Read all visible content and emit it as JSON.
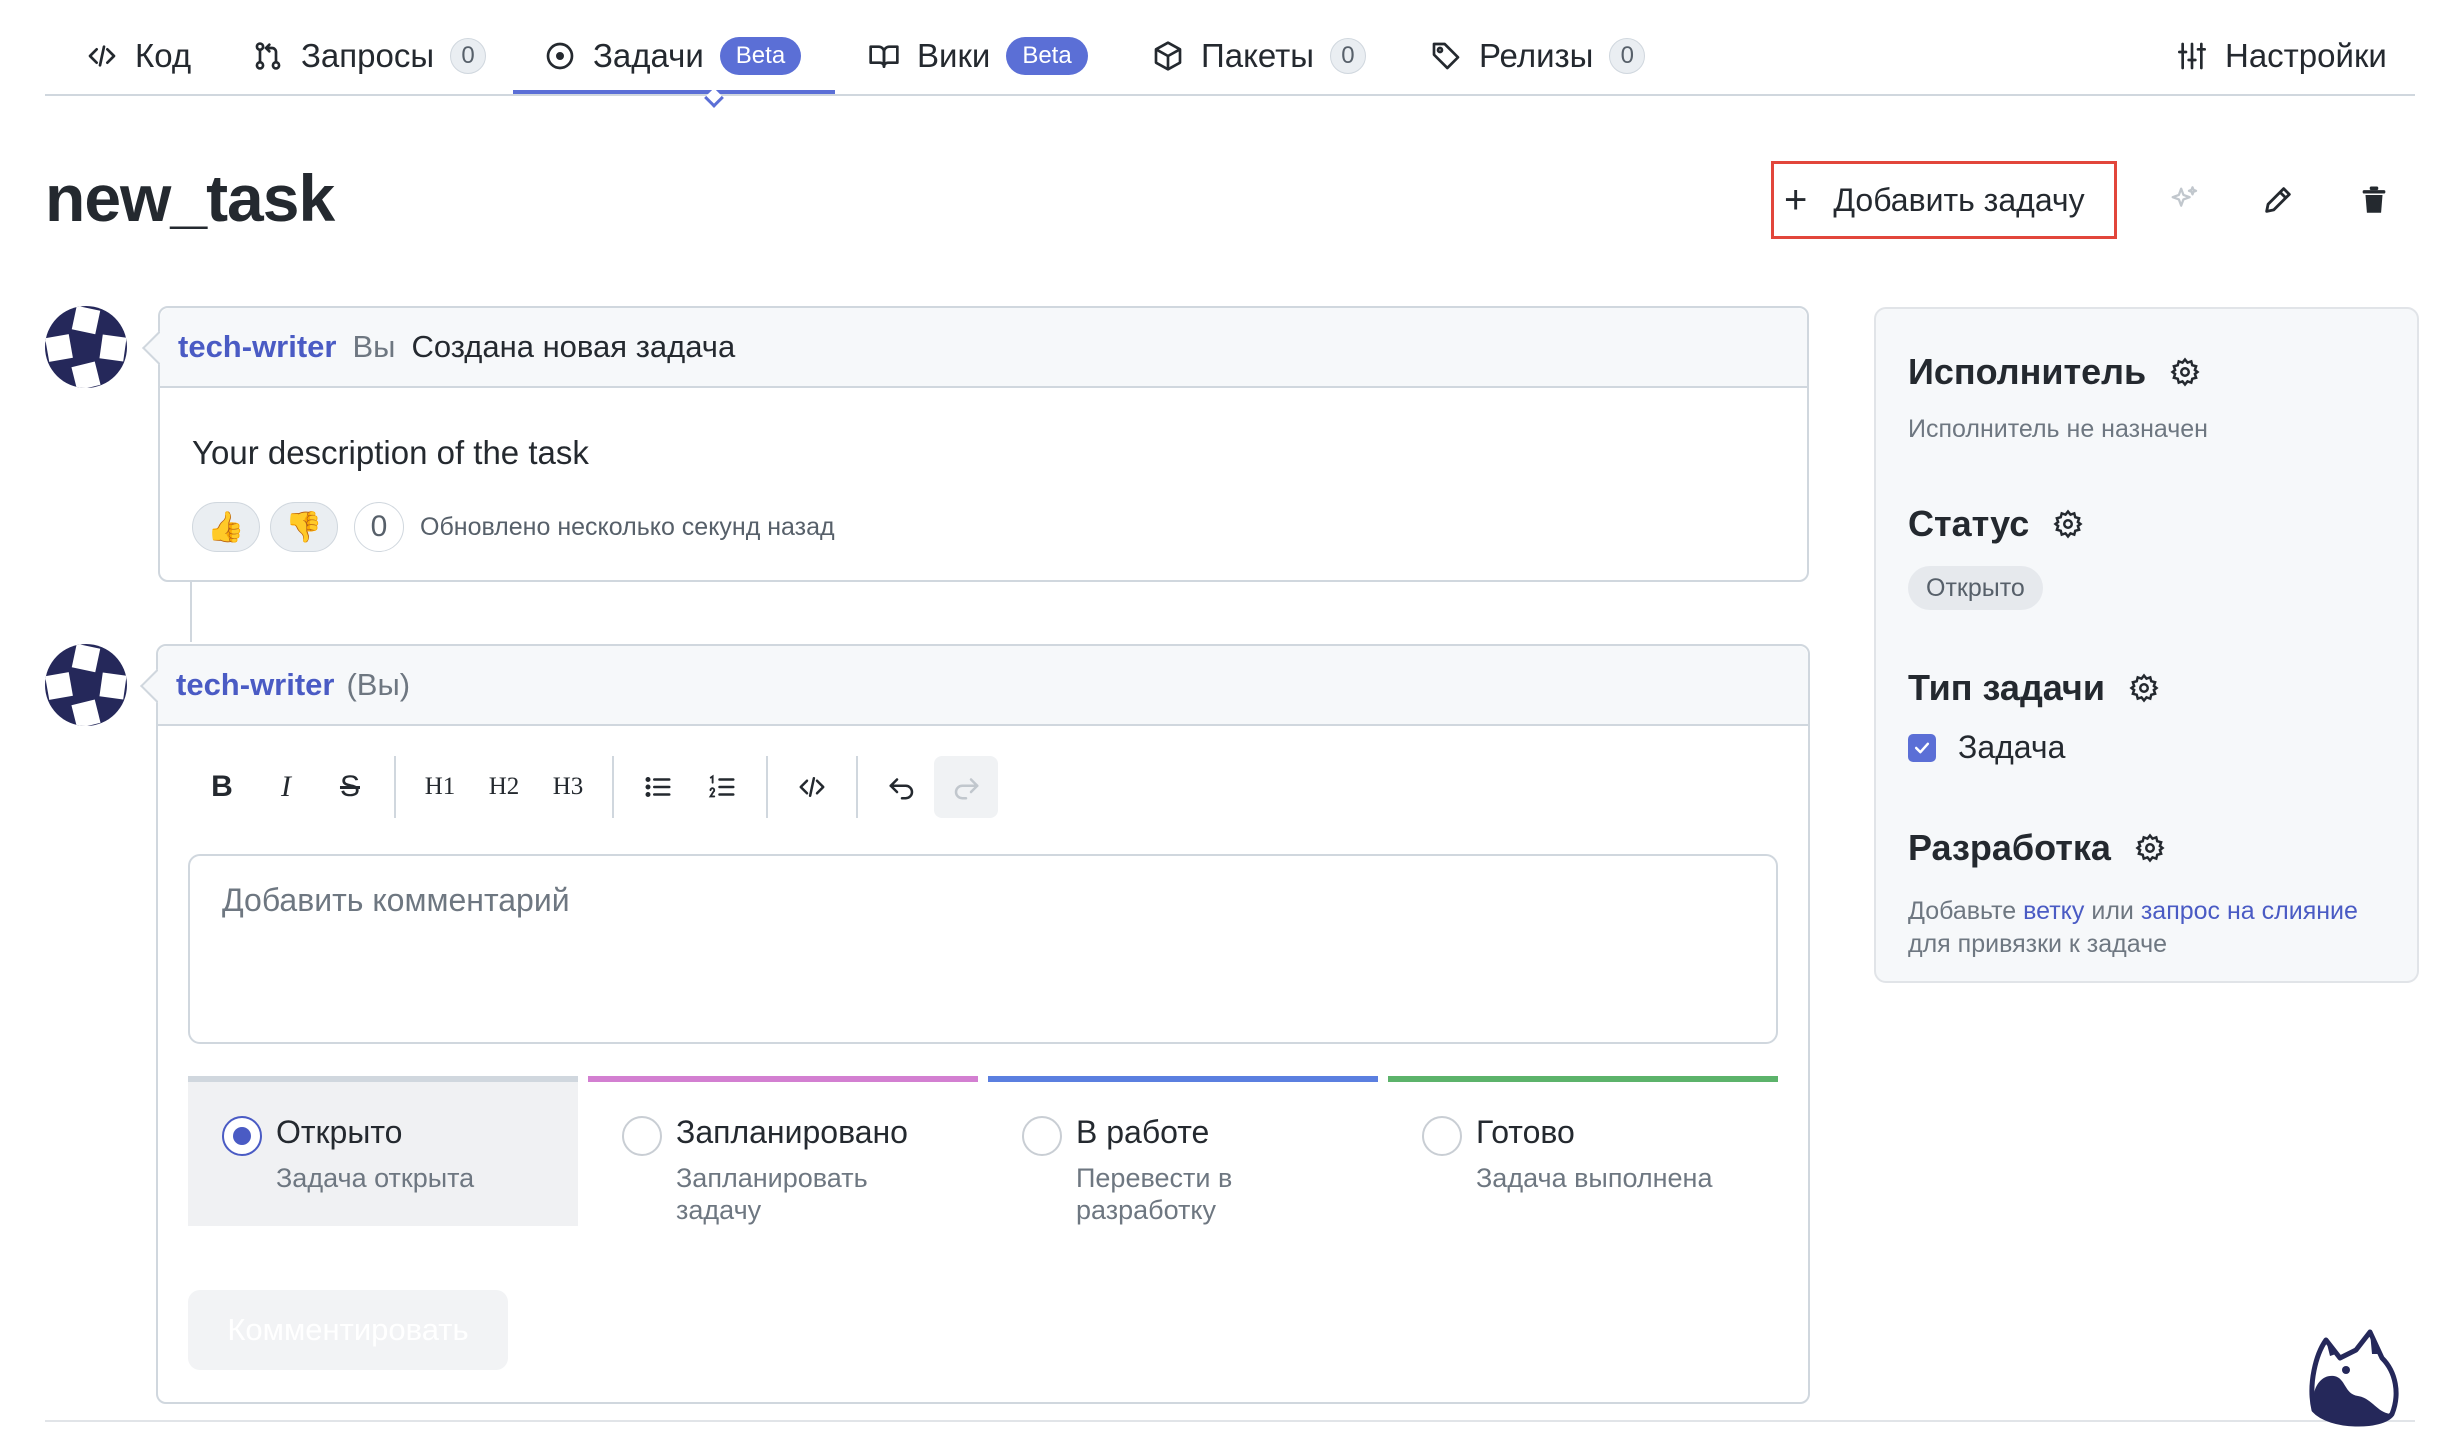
{
  "tabs": [
    {
      "label": "Код",
      "icon": "code-icon"
    },
    {
      "label": "Запросы",
      "icon": "pull-request-icon",
      "count": "0"
    },
    {
      "label": "Задачи",
      "icon": "issue-icon",
      "badge": "Beta",
      "active": true
    },
    {
      "label": "Вики",
      "icon": "book-icon",
      "badge": "Beta"
    },
    {
      "label": "Пакеты",
      "icon": "package-icon",
      "count": "0"
    },
    {
      "label": "Релизы",
      "icon": "tag-icon",
      "count": "0"
    },
    {
      "label": "Настройки",
      "icon": "settings-sliders-icon"
    }
  ],
  "header": {
    "title": "new_task",
    "add_task_label": "Добавить задачу",
    "add_task_icon": "plus-icon"
  },
  "event": {
    "author": "tech-writer",
    "you": "Вы",
    "action": "Создана новая задача",
    "description": "Your description of the task",
    "reaction_up": "👍",
    "reaction_down": "👎",
    "reaction_count": "0",
    "updated": "Обновлено несколько секунд назад"
  },
  "editor": {
    "author": "tech-writer",
    "you": "(Вы)",
    "toolbar": {
      "bold": "B",
      "italic": "I",
      "strike": "S",
      "h1": "H1",
      "h2": "H2",
      "h3": "H3"
    },
    "placeholder": "Добавить комментарий",
    "statuses": [
      {
        "label": "Открыто",
        "sub": "Задача открыта",
        "color": "#d0d7de",
        "selected": true
      },
      {
        "label": "Запланировано",
        "sub": "Запланировать задачу",
        "color": "#d37fd1"
      },
      {
        "label": "В работе",
        "sub": "Перевести в разработку",
        "color": "#5b7fe0"
      },
      {
        "label": "Готово",
        "sub": "Задача выполнена",
        "color": "#5cb36b"
      }
    ],
    "submit_label": "Комментировать"
  },
  "sidebar": {
    "assignee_title": "Исполнитель",
    "assignee_value": "Исполнитель не назначен",
    "status_title": "Статус",
    "status_value": "Открыто",
    "type_title": "Тип задачи",
    "type_value": "Задача",
    "dev_title": "Разработка",
    "dev_text_1": "Добавьте",
    "dev_link_branch": "ветку",
    "dev_text_2": "или",
    "dev_link_mr": "запрос на слияние",
    "dev_text_3": "для привязки к задаче"
  },
  "colors": {
    "accent": "#5b6fd6",
    "highlight_border": "#e2463b"
  }
}
